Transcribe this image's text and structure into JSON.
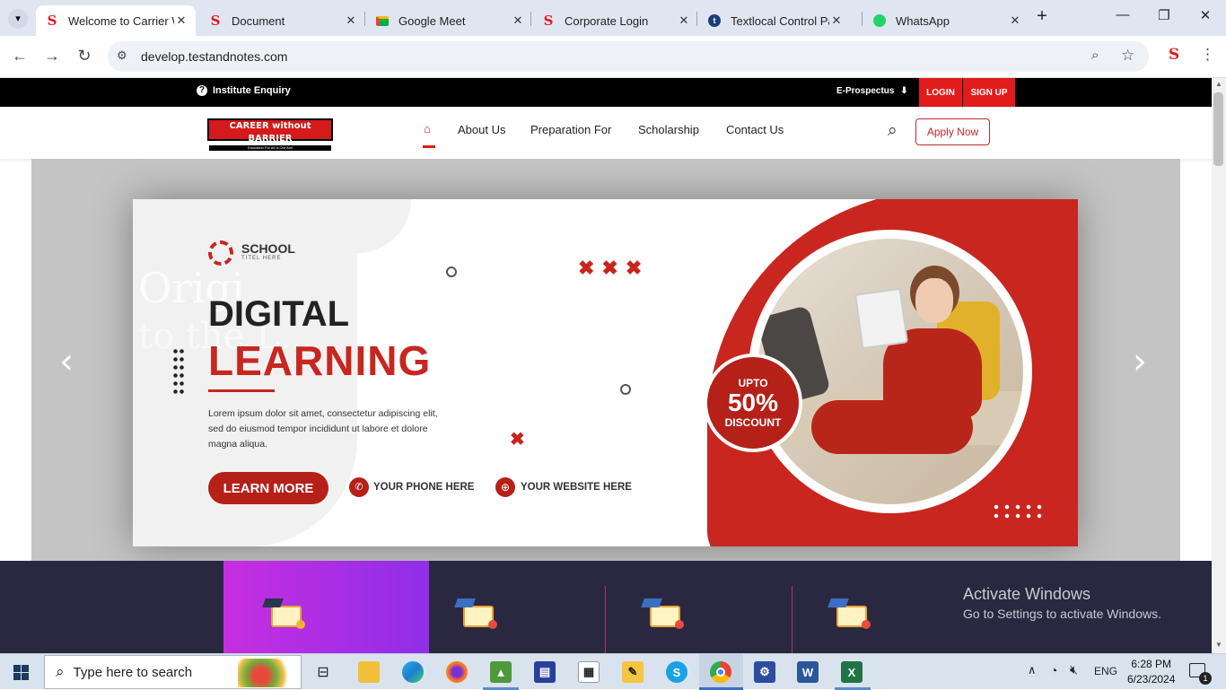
{
  "browser": {
    "tabs": [
      {
        "label": "Welcome to Carrier W",
        "icon": "site-s-logo",
        "active": true
      },
      {
        "label": "Document",
        "icon": "site-s-logo"
      },
      {
        "label": "Google Meet",
        "icon": "google-meet-logo"
      },
      {
        "label": "Corporate Login",
        "icon": "site-s-logo"
      },
      {
        "label": "Textlocal Control Pan",
        "icon": "textlocal-logo"
      },
      {
        "label": "WhatsApp",
        "icon": "whatsapp-logo"
      }
    ],
    "url": "develop.testandnotes.com"
  },
  "site": {
    "topbar": {
      "enquiry": "Institute Enquiry",
      "prospectus": "E-Prospectus",
      "login": "LOGIN",
      "signup": "SIGN UP"
    },
    "logo": {
      "line1": "CAREER without BARRIER",
      "line2": "Education For All Is Our Aim"
    },
    "nav": [
      "About Us",
      "Preparation For",
      "Scholarship",
      "Contact Us"
    ],
    "apply": "Apply Now",
    "banner": {
      "school": "SCHOOL",
      "school_sub": "TITEL HERE",
      "heading1": "DIGITAL",
      "heading2": "LEARNING",
      "body": "Lorem ipsum dolor sit amet, consectetur adipiscing elit, sed do eiusmod tempor incididunt ut labore et dolore magna aliqua.",
      "cta": "LEARN MORE",
      "phone": "YOUR PHONE HERE",
      "website": "YOUR WEBSITE HERE",
      "badge_top": "UPTO",
      "badge_value": "50%",
      "badge_bottom": "DISCOUNT",
      "watermark1": "Origi",
      "watermark2": "to the L..."
    }
  },
  "windows_watermark": {
    "title": "Activate Windows",
    "subtitle": "Go to Settings to activate Windows."
  },
  "taskbar": {
    "search_placeholder": "Type here to search",
    "language": "ENG",
    "time": "6:28 PM",
    "date": "6/23/2024",
    "notification_count": "1"
  },
  "colors": {
    "accent": "#e21b1b",
    "banner_red": "#c8261f",
    "footer_band": "#2a2840"
  }
}
